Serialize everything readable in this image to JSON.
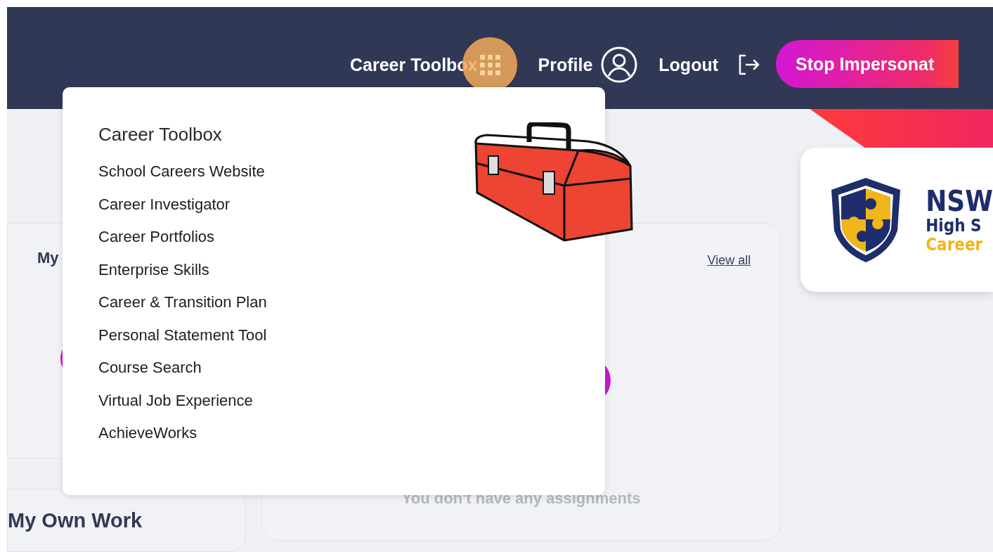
{
  "header": {
    "toolbox_link": {
      "label": "Career Toolbox",
      "expanded": true
    },
    "profile_link": {
      "label": "Profile"
    },
    "logout_link": {
      "label": "Logout"
    },
    "impersonate_button": {
      "label": "Stop Impersonat"
    }
  },
  "toolbox_menu": {
    "title": "Career Toolbox",
    "items": [
      "School Careers Website",
      "Career Investigator",
      "Career Portfolios",
      "Enterprise Skills",
      "Career & Transition Plan",
      "Personal Statement Tool",
      "Course Search",
      "Virtual Job Experience",
      "AchieveWorks"
    ]
  },
  "left_card": {
    "title": "My"
  },
  "assignments_card": {
    "link": "View all",
    "empty_message": "You don't have any assignments"
  },
  "own_work_card": {
    "title": "My Own Work"
  },
  "school_logo": {
    "lines": [
      "NSW",
      "High S",
      "Career"
    ]
  }
}
